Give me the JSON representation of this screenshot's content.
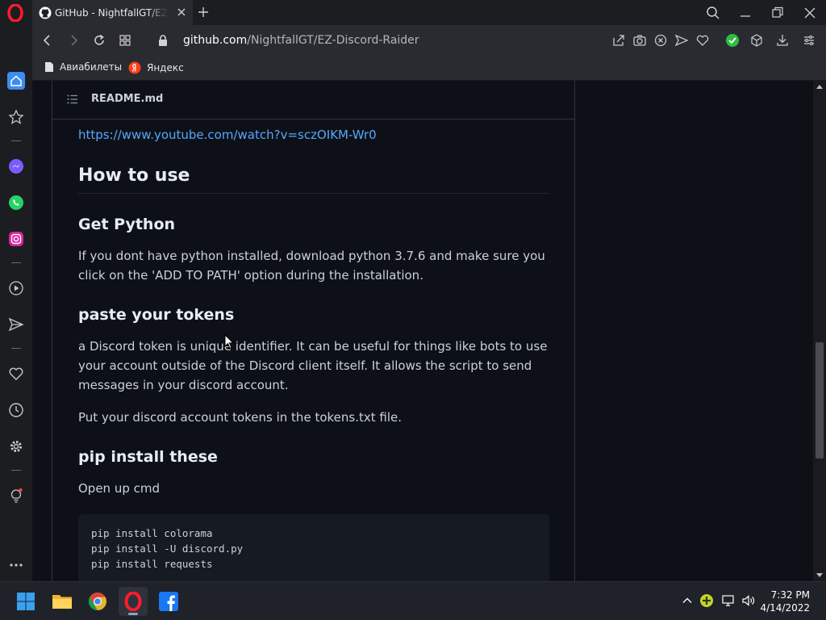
{
  "browser": {
    "tab_title": "GitHub - NightfallGT/EZ-Discord-Raider",
    "url_domain": "github.com",
    "url_path": "/NightfallGT/EZ-Discord-Raider",
    "bookmarks": [
      "Авиабилеты",
      "Яндекс"
    ]
  },
  "sidebar": {
    "icons": [
      "home-icon",
      "star-icon",
      "messenger-icon",
      "whatsapp-icon",
      "instagram-icon",
      "player-icon",
      "send-icon",
      "heart-icon",
      "history-icon",
      "settings-icon",
      "lightbulb-icon",
      "more-icon"
    ]
  },
  "readme": {
    "filename": "README.md",
    "video_link": "https://www.youtube.com/watch?v=sczOIKM-Wr0",
    "h_how_to_use": "How to use",
    "h_get_python": "Get Python",
    "p_get_python": "If you dont have python installed, download python 3.7.6 and make sure you click on the 'ADD TO PATH' option during the installation.",
    "h_paste_tokens": "paste your tokens",
    "p_token_desc": "a Discord token is unique identifier. It can be useful for things like bots to use your account outside of the Discord client itself. It allows the script to send messages in your discord account.",
    "p_token_file": "Put your discord account tokens in the tokens.txt file.",
    "h_pip": "pip install these",
    "p_open_cmd": "Open up cmd",
    "code_lines": [
      "pip install colorama",
      "pip install -U discord.py",
      "pip install requests"
    ]
  },
  "taskbar": {
    "apps": [
      "start-icon",
      "file-explorer-icon",
      "chrome-icon",
      "opera-icon",
      "facebook-icon"
    ],
    "time": "7:32 PM",
    "date": "4/14/2022"
  },
  "colors": {
    "page_bg": "#0d1117",
    "link": "#58a6ff",
    "chrome_bg": "#2a2b30",
    "opera_red": "#ff1b2d"
  }
}
